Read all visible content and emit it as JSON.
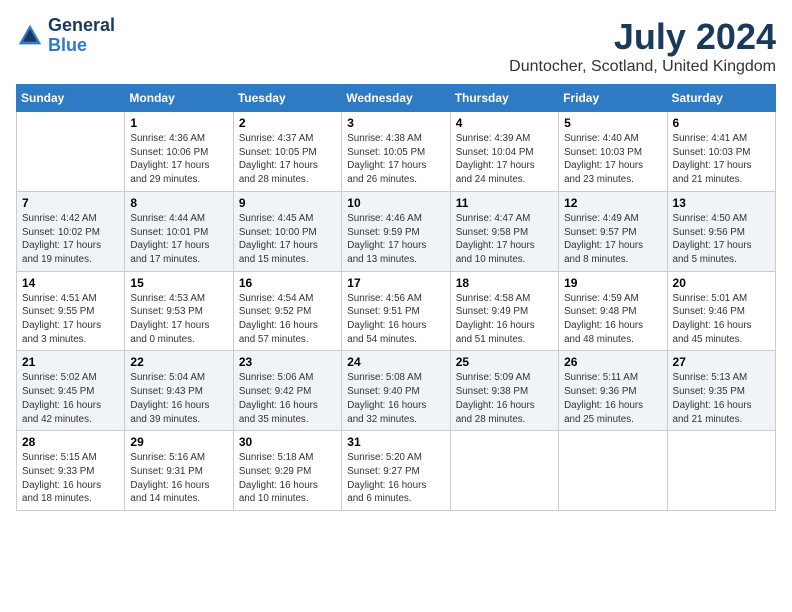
{
  "logo": {
    "line1": "General",
    "line2": "Blue"
  },
  "title": "July 2024",
  "location": "Duntocher, Scotland, United Kingdom",
  "headers": [
    "Sunday",
    "Monday",
    "Tuesday",
    "Wednesday",
    "Thursday",
    "Friday",
    "Saturday"
  ],
  "weeks": [
    [
      {
        "day": "",
        "info": ""
      },
      {
        "day": "1",
        "info": "Sunrise: 4:36 AM\nSunset: 10:06 PM\nDaylight: 17 hours\nand 29 minutes."
      },
      {
        "day": "2",
        "info": "Sunrise: 4:37 AM\nSunset: 10:05 PM\nDaylight: 17 hours\nand 28 minutes."
      },
      {
        "day": "3",
        "info": "Sunrise: 4:38 AM\nSunset: 10:05 PM\nDaylight: 17 hours\nand 26 minutes."
      },
      {
        "day": "4",
        "info": "Sunrise: 4:39 AM\nSunset: 10:04 PM\nDaylight: 17 hours\nand 24 minutes."
      },
      {
        "day": "5",
        "info": "Sunrise: 4:40 AM\nSunset: 10:03 PM\nDaylight: 17 hours\nand 23 minutes."
      },
      {
        "day": "6",
        "info": "Sunrise: 4:41 AM\nSunset: 10:03 PM\nDaylight: 17 hours\nand 21 minutes."
      }
    ],
    [
      {
        "day": "7",
        "info": "Sunrise: 4:42 AM\nSunset: 10:02 PM\nDaylight: 17 hours\nand 19 minutes."
      },
      {
        "day": "8",
        "info": "Sunrise: 4:44 AM\nSunset: 10:01 PM\nDaylight: 17 hours\nand 17 minutes."
      },
      {
        "day": "9",
        "info": "Sunrise: 4:45 AM\nSunset: 10:00 PM\nDaylight: 17 hours\nand 15 minutes."
      },
      {
        "day": "10",
        "info": "Sunrise: 4:46 AM\nSunset: 9:59 PM\nDaylight: 17 hours\nand 13 minutes."
      },
      {
        "day": "11",
        "info": "Sunrise: 4:47 AM\nSunset: 9:58 PM\nDaylight: 17 hours\nand 10 minutes."
      },
      {
        "day": "12",
        "info": "Sunrise: 4:49 AM\nSunset: 9:57 PM\nDaylight: 17 hours\nand 8 minutes."
      },
      {
        "day": "13",
        "info": "Sunrise: 4:50 AM\nSunset: 9:56 PM\nDaylight: 17 hours\nand 5 minutes."
      }
    ],
    [
      {
        "day": "14",
        "info": "Sunrise: 4:51 AM\nSunset: 9:55 PM\nDaylight: 17 hours\nand 3 minutes."
      },
      {
        "day": "15",
        "info": "Sunrise: 4:53 AM\nSunset: 9:53 PM\nDaylight: 17 hours\nand 0 minutes."
      },
      {
        "day": "16",
        "info": "Sunrise: 4:54 AM\nSunset: 9:52 PM\nDaylight: 16 hours\nand 57 minutes."
      },
      {
        "day": "17",
        "info": "Sunrise: 4:56 AM\nSunset: 9:51 PM\nDaylight: 16 hours\nand 54 minutes."
      },
      {
        "day": "18",
        "info": "Sunrise: 4:58 AM\nSunset: 9:49 PM\nDaylight: 16 hours\nand 51 minutes."
      },
      {
        "day": "19",
        "info": "Sunrise: 4:59 AM\nSunset: 9:48 PM\nDaylight: 16 hours\nand 48 minutes."
      },
      {
        "day": "20",
        "info": "Sunrise: 5:01 AM\nSunset: 9:46 PM\nDaylight: 16 hours\nand 45 minutes."
      }
    ],
    [
      {
        "day": "21",
        "info": "Sunrise: 5:02 AM\nSunset: 9:45 PM\nDaylight: 16 hours\nand 42 minutes."
      },
      {
        "day": "22",
        "info": "Sunrise: 5:04 AM\nSunset: 9:43 PM\nDaylight: 16 hours\nand 39 minutes."
      },
      {
        "day": "23",
        "info": "Sunrise: 5:06 AM\nSunset: 9:42 PM\nDaylight: 16 hours\nand 35 minutes."
      },
      {
        "day": "24",
        "info": "Sunrise: 5:08 AM\nSunset: 9:40 PM\nDaylight: 16 hours\nand 32 minutes."
      },
      {
        "day": "25",
        "info": "Sunrise: 5:09 AM\nSunset: 9:38 PM\nDaylight: 16 hours\nand 28 minutes."
      },
      {
        "day": "26",
        "info": "Sunrise: 5:11 AM\nSunset: 9:36 PM\nDaylight: 16 hours\nand 25 minutes."
      },
      {
        "day": "27",
        "info": "Sunrise: 5:13 AM\nSunset: 9:35 PM\nDaylight: 16 hours\nand 21 minutes."
      }
    ],
    [
      {
        "day": "28",
        "info": "Sunrise: 5:15 AM\nSunset: 9:33 PM\nDaylight: 16 hours\nand 18 minutes."
      },
      {
        "day": "29",
        "info": "Sunrise: 5:16 AM\nSunset: 9:31 PM\nDaylight: 16 hours\nand 14 minutes."
      },
      {
        "day": "30",
        "info": "Sunrise: 5:18 AM\nSunset: 9:29 PM\nDaylight: 16 hours\nand 10 minutes."
      },
      {
        "day": "31",
        "info": "Sunrise: 5:20 AM\nSunset: 9:27 PM\nDaylight: 16 hours\nand 6 minutes."
      },
      {
        "day": "",
        "info": ""
      },
      {
        "day": "",
        "info": ""
      },
      {
        "day": "",
        "info": ""
      }
    ]
  ]
}
